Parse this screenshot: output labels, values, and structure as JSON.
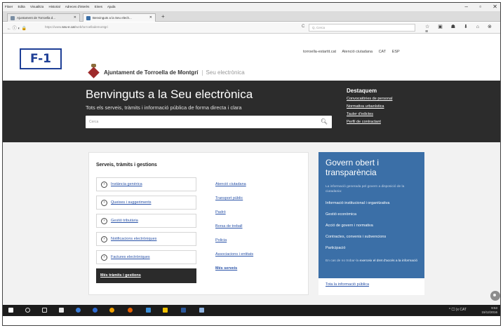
{
  "browser": {
    "menu": [
      "Fitxer",
      "Edita",
      "Visualitza",
      "Historial",
      "Adreces d'interès",
      "Eines",
      "Ajuda"
    ],
    "window_controls": {
      "minimize": "–",
      "maximize": "▫",
      "close": "✕"
    },
    "tabs": [
      {
        "label": "Ajuntament de Torroella d...",
        "close": "✕"
      },
      {
        "label": "Benvinguts a la Seu elech...",
        "close": "✕"
      }
    ],
    "new_tab": "+",
    "nav_icons": "← ⓘ ◐ 🔒",
    "url_prefix": "https://www.",
    "url_host": "seu-e.cat",
    "url_path": "/web/torroellademontgri",
    "reload": "C",
    "search_placeholder": "Q, Cerca",
    "toolbar_icons": "☆ ▣ ☗ ⬇ ⌂ ⊗ ≡"
  },
  "header": {
    "badge": "F-1",
    "site_name": "Ajuntament de Torroella de Montgrí",
    "site_sub": "Seu electrònica",
    "top_links": [
      "torroella-estartit.cat",
      "Atenció ciutadana",
      "CAT",
      "ESP"
    ]
  },
  "hero": {
    "title": "Benvinguts a la Seu electrònica",
    "subtitle": "Tots els serveis, tràmits i informació pública de forma directa i clara",
    "search_placeholder": "Cerca",
    "destaquem_title": "Destaquem",
    "destaquem_links": [
      "Convocatòries de personal",
      "Normativa urbanística",
      "Tauler d'edictes",
      "Perfil de contractant"
    ]
  },
  "services": {
    "title": "Serveis, tràmits i gestions",
    "items": [
      "Instància genèrica",
      "Queixes i suggeriments",
      "Gestió tributària",
      "Notificacions electròniques",
      "Factures electròniques"
    ],
    "more_label": "Més tràmits i gestions",
    "quick_links": [
      "Atenció ciutadana",
      "Transport públic",
      "Padró",
      "Borsa de treball",
      "Policia",
      "Associacions i entitats"
    ],
    "more_services": "Més serveis"
  },
  "govern": {
    "title": "Govern obert i transparència",
    "intro": "La informació generada pel govern a disposició de la ciutadania:",
    "links": [
      "Informació institucional i organitzativa",
      "Gestió econòmica",
      "Acció de govern i normativa",
      "Contractes, convenis i subvencions",
      "Participació"
    ],
    "note_prefix": "En cas de no trobar-la",
    "note_link": "exerceix el dret d'accés a la informació",
    "all_link": "Tota la informació pública"
  },
  "taskbar": {
    "tray_icons": "^ 🖵 (x CAT",
    "time": "9:53",
    "date": "15/12/2016"
  },
  "colors": {
    "hero_bg": "#2c2c2c",
    "govern_blue": "#3b6fa7",
    "link_blue": "#2a53a8",
    "badge_blue": "#1e3f96"
  }
}
